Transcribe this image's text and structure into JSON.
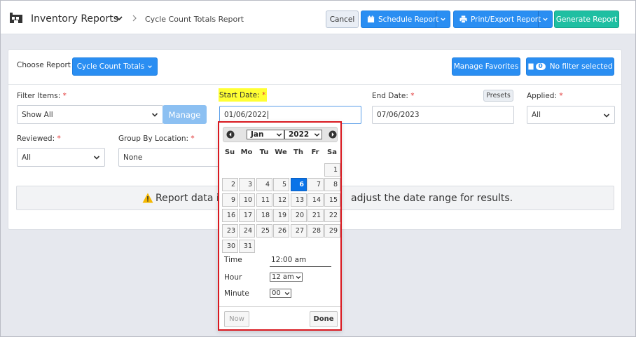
{
  "header": {
    "title": "Inventory Reports",
    "breadcrumb": "Cycle Count Totals Report",
    "cancel_label": "Cancel",
    "schedule_label": "Schedule Report",
    "print_label": "Print/Export Report",
    "generate_label": "Generate Report"
  },
  "report_bar": {
    "choose_label": "Choose Report",
    "report_value": "Cycle Count Totals",
    "manage_favorites": "Manage Favorites",
    "filter_count": "0",
    "filter_text": "No filter selected"
  },
  "filters": {
    "filter_items_label": "Filter Items:",
    "filter_items_value": "Show All",
    "manage_label": "Manage",
    "start_date_label": "Start Date:",
    "start_date_value": "01/06/2022",
    "end_date_label": "End Date:",
    "end_date_value": "07/06/2023",
    "presets_label": "Presets",
    "applied_label": "Applied:",
    "applied_value": "All",
    "reviewed_label": "Reviewed:",
    "reviewed_value": "All",
    "group_by_label": "Group By Location:",
    "group_by_value": "None",
    "required_mark": "*"
  },
  "notice": {
    "text_left": "Report data is e",
    "text_right": "adjust the date range for results."
  },
  "datepicker": {
    "month": "Jan",
    "year": "2022",
    "weekdays": [
      "Su",
      "Mo",
      "Tu",
      "We",
      "Th",
      "Fr",
      "Sa"
    ],
    "days": [
      "1",
      "2",
      "3",
      "4",
      "5",
      "6",
      "7",
      "8",
      "9",
      "10",
      "11",
      "12",
      "13",
      "14",
      "15",
      "16",
      "17",
      "18",
      "19",
      "20",
      "21",
      "22",
      "23",
      "24",
      "25",
      "26",
      "27",
      "28",
      "29",
      "30",
      "31"
    ],
    "selected_day": "6",
    "time_label": "Time",
    "time_value": "12:00 am",
    "hour_label": "Hour",
    "hour_value": "12 am",
    "minute_label": "Minute",
    "minute_value": "00",
    "now_label": "Now",
    "done_label": "Done"
  },
  "colors": {
    "primary": "#2a8ef2",
    "accent_green": "#1fbfa2",
    "selected_day": "#0a73e8",
    "highlight": "#ffff33",
    "outline": "#d9181f"
  }
}
